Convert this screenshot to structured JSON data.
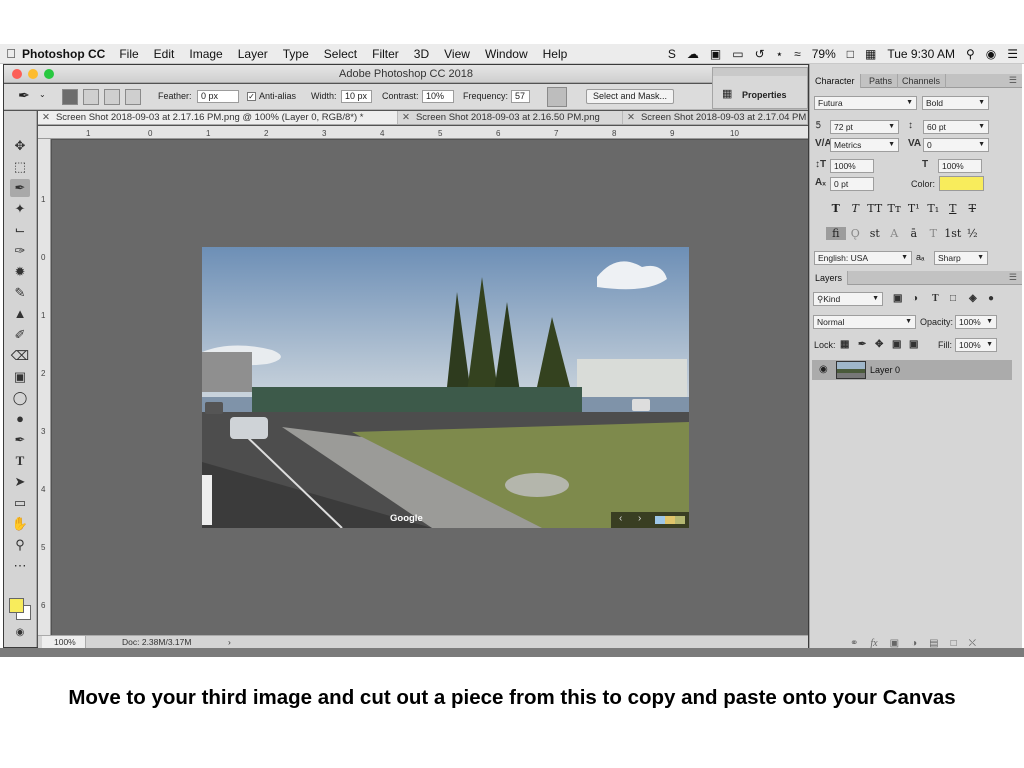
{
  "menubar": {
    "app_name": "Photoshop CC",
    "items": [
      "File",
      "Edit",
      "Image",
      "Layer",
      "Type",
      "Select",
      "Filter",
      "3D",
      "View",
      "Window",
      "Help"
    ],
    "battery": "79%",
    "clock": "Tue 9:30 AM"
  },
  "window": {
    "title": "Adobe Photoshop CC 2018"
  },
  "options": {
    "feather_label": "Feather:",
    "feather_value": "0 px",
    "antialias_label": "Anti-alias",
    "width_label": "Width:",
    "width_value": "10 px",
    "contrast_label": "Contrast:",
    "contrast_value": "10%",
    "frequency_label": "Frequency:",
    "frequency_value": "57",
    "select_mask_label": "Select and Mask..."
  },
  "tabs": [
    {
      "label": "Screen Shot 2018-09-03 at 2.17.16 PM.png @ 100% (Layer 0, RGB/8*) *"
    },
    {
      "label": "Screen Shot 2018-09-03 at 2.16.50 PM.png"
    },
    {
      "label": "Screen Shot 2018-09-03 at 2.17.04 PM"
    }
  ],
  "ruler": {
    "h_ticks": [
      "1",
      "0",
      "1",
      "2",
      "3",
      "4",
      "5",
      "6",
      "7",
      "8",
      "9",
      "10"
    ],
    "v_ticks": [
      "1",
      "0",
      "1",
      "2",
      "3",
      "4",
      "5",
      "6"
    ]
  },
  "photo": {
    "watermark": "Google"
  },
  "status": {
    "zoom": "100%",
    "doc": "Doc: 2.38M/3.17M"
  },
  "properties_panel": {
    "label": "Properties"
  },
  "character_panel": {
    "tabs": [
      "Character",
      "Paths",
      "Channels"
    ],
    "font_family": "Futura",
    "font_style": "Bold",
    "font_size": "72 pt",
    "leading": "60 pt",
    "kerning": "Metrics",
    "tracking": "0",
    "vertical_scale": "100%",
    "horizontal_scale": "100%",
    "baseline_shift": "0 pt",
    "color_label": "Color:",
    "color_value": "#f8ec5c",
    "language": "English: USA",
    "aa_label": "aₐ",
    "antialias": "Sharp"
  },
  "layers_panel": {
    "tab": "Layers",
    "filter": "Kind",
    "blend_mode": "Normal",
    "opacity_label": "Opacity:",
    "opacity_value": "100%",
    "lock_label": "Lock:",
    "fill_label": "Fill:",
    "fill_value": "100%",
    "layers": [
      {
        "name": "Layer 0",
        "visible": true
      }
    ]
  },
  "caption": "Move to your third image and cut out a piece from this to copy and paste onto your Canvas"
}
